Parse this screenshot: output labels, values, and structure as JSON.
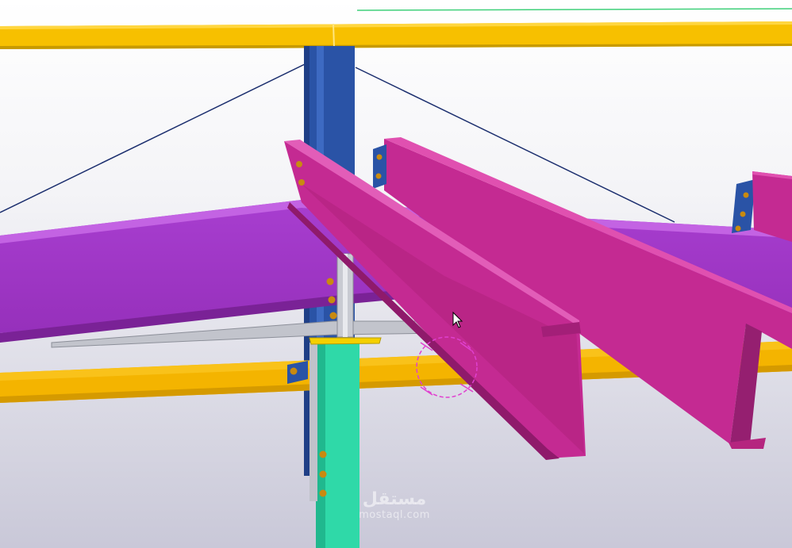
{
  "scene": {
    "kind": "3d-steel-structure-model",
    "cursor": "arrow-pointer-icon",
    "selection_marker": "dashed-circle-icon"
  },
  "colors": {
    "yellow_beam": "#f5bd00",
    "blue_column": "#2a53a6",
    "purple_rafter": "#a236c6",
    "magenta_purlin": "#c42a92",
    "teal_column": "#2fd9a8",
    "gray_plate": "#c2c4cc",
    "bolt": "#c98a10",
    "brace_line": "#1b2e6e",
    "selection": "#e040d0"
  },
  "watermark": {
    "logo": "مستقل",
    "url": "mostaql.com"
  }
}
